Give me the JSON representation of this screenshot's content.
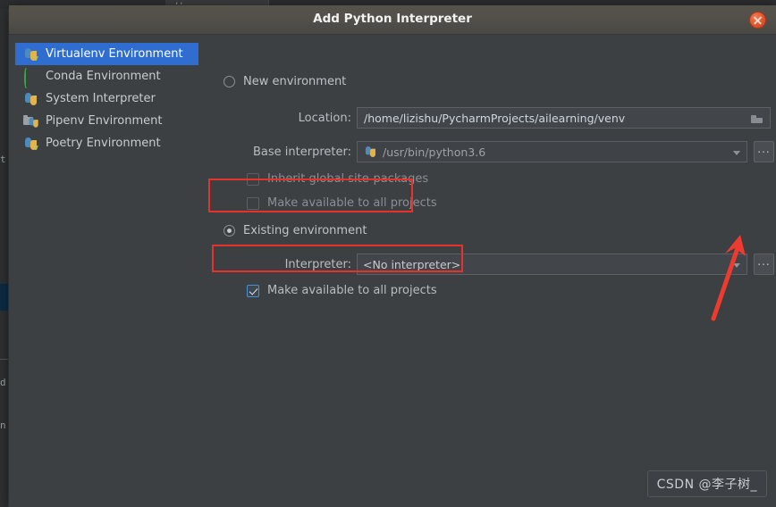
{
  "window": {
    "title": "Add Python Interpreter",
    "close_label": "Close"
  },
  "sidebar": {
    "items": [
      {
        "label": "Virtualenv Environment",
        "icon": "python-venv-icon",
        "selected": true
      },
      {
        "label": "Conda Environment",
        "icon": "conda-icon",
        "selected": false
      },
      {
        "label": "System Interpreter",
        "icon": "python-icon",
        "selected": false
      },
      {
        "label": "Pipenv Environment",
        "icon": "pipenv-folder-icon",
        "selected": false
      },
      {
        "label": "Poetry Environment",
        "icon": "python-venv-icon",
        "selected": false
      }
    ]
  },
  "form": {
    "new_environment": {
      "radio_label": "New environment",
      "selected": false,
      "location_label": "Location:",
      "location_value": "/home/lizishu/PycharmProjects/ailearning/venv",
      "location_browse_icon": "folder-icon",
      "base_interpreter_label": "Base interpreter:",
      "base_interpreter_value": "/usr/bin/python3.6",
      "base_interpreter_icon": "python-icon",
      "base_interpreter_more_label": "...",
      "inherit_label": "Inherit global site-packages",
      "inherit_checked": false,
      "make_available_label": "Make available to all projects",
      "make_available_checked": false
    },
    "existing_environment": {
      "radio_label": "Existing environment",
      "selected": true,
      "interpreter_label": "Interpreter:",
      "interpreter_value": "<No interpreter>",
      "interpreter_more_label": "...",
      "make_available_label": "Make available to all projects",
      "make_available_checked": true
    }
  },
  "annotations": {
    "accent_color": "#e8312a",
    "box_existing_environment": "highlight-existing-environment",
    "box_make_available": "highlight-make-available",
    "arrow": "arrow-pointing-to-interpreter-browse-button"
  },
  "watermark": {
    "text": "CSDN @李子树_"
  },
  "background": {
    "editor_line_1": "t",
    "editor_line_2": "d a",
    "editor_line_3": "n"
  }
}
